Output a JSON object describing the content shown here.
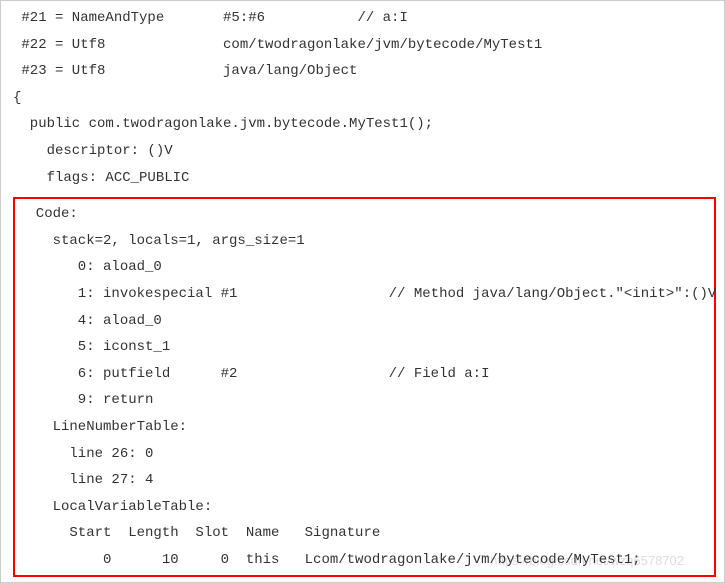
{
  "constantPool": {
    "entry21": " #21 = NameAndType       #5:#6           // a:I",
    "entry22": " #22 = Utf8              com/twodragonlake/jvm/bytecode/MyTest1",
    "entry23": " #23 = Utf8              java/lang/Object"
  },
  "openBrace": "{",
  "methodDecl": "  public com.twodragonlake.jvm.bytecode.MyTest1();",
  "descriptor": "    descriptor: ()V",
  "flags": "    flags: ACC_PUBLIC",
  "codeBlock": {
    "header": "  Code:",
    "stackLine": "    stack=2, locals=1, args_size=1",
    "instr0": "       0: aload_0",
    "instr1": "       1: invokespecial #1                  // Method java/lang/Object.\"<init>\":()V",
    "instr4": "       4: aload_0",
    "instr5": "       5: iconst_1",
    "instr6": "       6: putfield      #2                  // Field a:I",
    "instr9": "       9: return",
    "lineNumberTableHeader": "    LineNumberTable:",
    "lineNum1": "      line 26: 0",
    "lineNum2": "      line 27: 4",
    "localVarTableHeader": "    LocalVariableTable:",
    "localVarColumns": "      Start  Length  Slot  Name   Signature",
    "localVarRow": "          0      10     0  this   Lcom/twodragonlake/jvm/bytecode/MyTest1;"
  },
  "watermark": "https://blog.csdn.net/wzq6578702"
}
